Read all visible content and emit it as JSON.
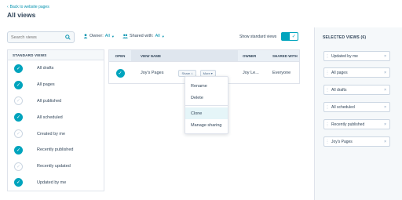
{
  "header": {
    "back_link": "Back to website pages",
    "title": "All views"
  },
  "toolbar": {
    "search_placeholder": "Search views",
    "owner_label": "Owner:",
    "owner_value": "All",
    "shared_label": "Shared with:",
    "shared_value": "All",
    "standard_toggle_label": "Show standard views",
    "standard_toggle_on": true
  },
  "standard_views": {
    "header": "STANDARD VIEWS",
    "items": [
      {
        "label": "All drafts",
        "checked": true
      },
      {
        "label": "All pages",
        "checked": true
      },
      {
        "label": "All published",
        "checked": false
      },
      {
        "label": "All scheduled",
        "checked": true
      },
      {
        "label": "Created by me",
        "checked": false
      },
      {
        "label": "Recently published",
        "checked": true
      },
      {
        "label": "Recently updated",
        "checked": false
      },
      {
        "label": "Updated by me",
        "checked": true
      }
    ]
  },
  "table": {
    "headers": {
      "open": "OPEN",
      "name": "VIEW NAME",
      "owner": "OWNER",
      "shared": "SHARED WITH"
    },
    "rows": [
      {
        "open": true,
        "name": "Joy's Pages",
        "share_label": "Share",
        "more_label": "More",
        "owner": "Joy Le...",
        "shared": "Everyone"
      }
    ]
  },
  "more_menu": {
    "items": [
      "Rename",
      "Delete",
      "Clone",
      "Manage sharing"
    ],
    "highlighted": "Clone"
  },
  "selected_views": {
    "title": "SELECTED VIEWS (6)",
    "items": [
      "Updated by me",
      "All pages",
      "All drafts",
      "All scheduled",
      "Recently published",
      "Joy's Pages"
    ]
  },
  "colors": {
    "accent": "#00a4bd",
    "link": "#0091ae",
    "text": "#33475b"
  }
}
